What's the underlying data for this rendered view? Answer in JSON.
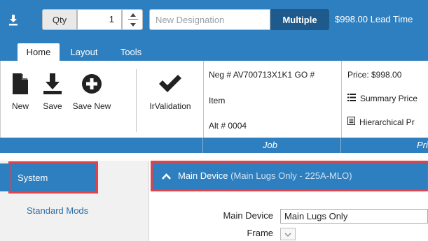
{
  "topbar": {
    "download_icon": "download-icon",
    "qty_label": "Qty",
    "qty_value": "1",
    "designation_placeholder": "New Designation",
    "multiple_label": "Multiple",
    "summary_text": "$998.00  Lead Time"
  },
  "tabs": [
    {
      "label": "Home",
      "active": true
    },
    {
      "label": "Layout",
      "active": false
    },
    {
      "label": "Tools",
      "active": false
    }
  ],
  "ribbon": {
    "buttons": [
      {
        "label": "New",
        "icon": "new-document-icon"
      },
      {
        "label": "Save",
        "icon": "download-save-icon"
      },
      {
        "label": "Save New",
        "icon": "plus-circle-icon"
      },
      {
        "label": "IrValidation",
        "icon": "checkmark-icon"
      }
    ],
    "job": {
      "line1": "Neg # AV700713X1K1  GO #",
      "line2": "Item",
      "line3": "Alt # 0004"
    },
    "pricing": {
      "price": "Price: $998.00",
      "summary_link": "Summary Price",
      "hierarchical_link": "Hierarchical Pr"
    }
  },
  "groups": {
    "job_label": "Job",
    "pricing_label": "Pri"
  },
  "sidebar": {
    "items": [
      {
        "label": "System",
        "selected": true
      },
      {
        "label": "Standard Mods",
        "selected": false
      }
    ]
  },
  "main": {
    "section_title": "Main Device",
    "section_subtitle": "(Main Lugs Only - 225A-MLO)",
    "fields": {
      "main_device_label": "Main Device",
      "main_device_value": "Main Lugs Only",
      "frame_label": "Frame"
    }
  },
  "colors": {
    "brand_blue": "#2e7fbf",
    "dark_blue": "#1e5a8c",
    "highlight_red": "#e0434b"
  }
}
